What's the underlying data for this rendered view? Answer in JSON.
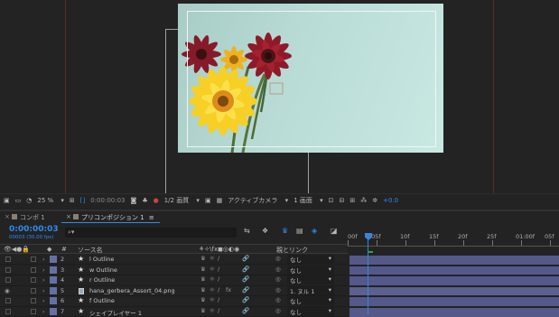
{
  "viewer_toolbar": {
    "zoom": "25 %",
    "timecode": "0:00:00:03",
    "resolution": "1/2 画質",
    "camera": "アクティブカメラ",
    "views": "1 画面",
    "exposure": "+0.0"
  },
  "tabs": [
    {
      "label": "コンポ 1"
    },
    {
      "label": "プリコンポジション 1"
    }
  ],
  "tab_menu_glyph": "≡",
  "timeline": {
    "current_time": "0:00:00:03",
    "fps": "00003 (30.00 fps)",
    "search_placeholder": "⌕▾",
    "columns": {
      "hash": "#",
      "source_name": "ソース名",
      "switches": "⚘✧\\fx◼◎◐◉",
      "parent": "親とリンク"
    },
    "ruler_ticks": [
      "00f",
      "05f",
      "10f",
      "15f",
      "20f",
      "25f",
      "01:00f",
      "05f"
    ],
    "layers": [
      {
        "num": "2",
        "name": "l Outline",
        "type": "shape",
        "parent": "なし",
        "fx": ""
      },
      {
        "num": "3",
        "name": "w Outline",
        "type": "shape",
        "parent": "なし",
        "fx": ""
      },
      {
        "num": "4",
        "name": "r Outline",
        "type": "shape",
        "parent": "なし",
        "fx": ""
      },
      {
        "num": "5",
        "name": "hana_gerbera_Assort_04.png",
        "type": "footage",
        "parent": "1. ヌル 1",
        "fx": "fx"
      },
      {
        "num": "6",
        "name": "f Outline",
        "type": "shape",
        "parent": "なし",
        "fx": ""
      },
      {
        "num": "7",
        "name": "シェイプレイヤー 1",
        "type": "shape",
        "parent": "なし",
        "fx": ""
      }
    ]
  },
  "colors": {
    "accent_blue": "#2d8ceb",
    "layer_bar": "#54588a",
    "label": "#6571a4",
    "playhead": "#3d82d8"
  }
}
